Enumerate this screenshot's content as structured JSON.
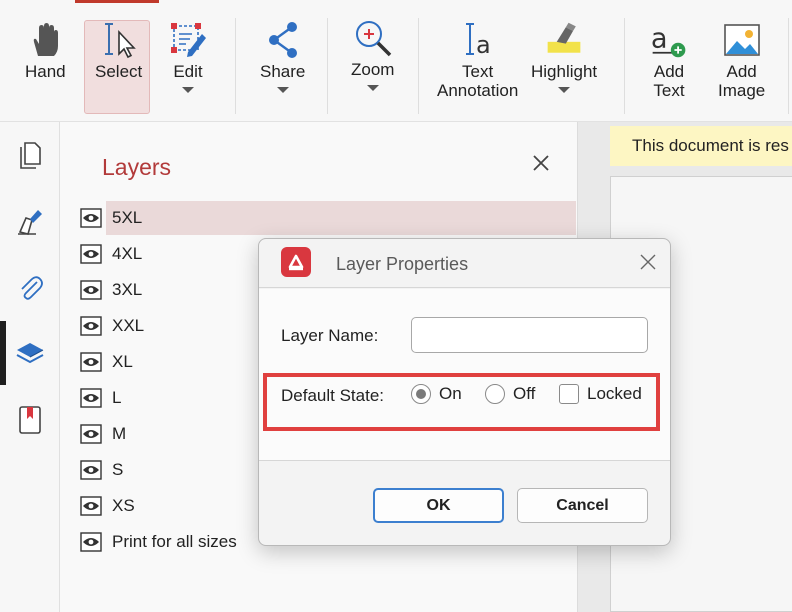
{
  "toolbar": {
    "hand": "Hand",
    "select": "Select",
    "edit": "Edit",
    "share": "Share",
    "zoom": "Zoom",
    "text_annotation_1": "Text",
    "text_annotation_2": "Annotation",
    "highlight": "Highlight",
    "add_text_1": "Add",
    "add_text_2": "Text",
    "add_image_1": "Add",
    "add_image_2": "Image"
  },
  "rail": [
    "pages-icon",
    "sign-icon",
    "attachment-icon",
    "layers-icon",
    "bookmark-icon"
  ],
  "layers_panel": {
    "title": "Layers",
    "items": [
      "5XL",
      "4XL",
      "3XL",
      "XXL",
      "XL",
      "L",
      "M",
      "S",
      "XS",
      "Print for all sizes"
    ],
    "selected": "5XL"
  },
  "document": {
    "banner": "This document is res"
  },
  "dialog": {
    "title": "Layer Properties",
    "layer_name_label": "Layer Name:",
    "layer_name_value": "",
    "default_state_label": "Default State:",
    "on_label": "On",
    "off_label": "Off",
    "locked_label": "Locked",
    "state": "On",
    "locked": false,
    "ok_label": "OK",
    "cancel_label": "Cancel"
  },
  "colors": {
    "accent": "#b23a3a",
    "highlight_box": "#e0403f",
    "ok_border": "#3c7fcf",
    "banner": "#fdf6c3"
  }
}
